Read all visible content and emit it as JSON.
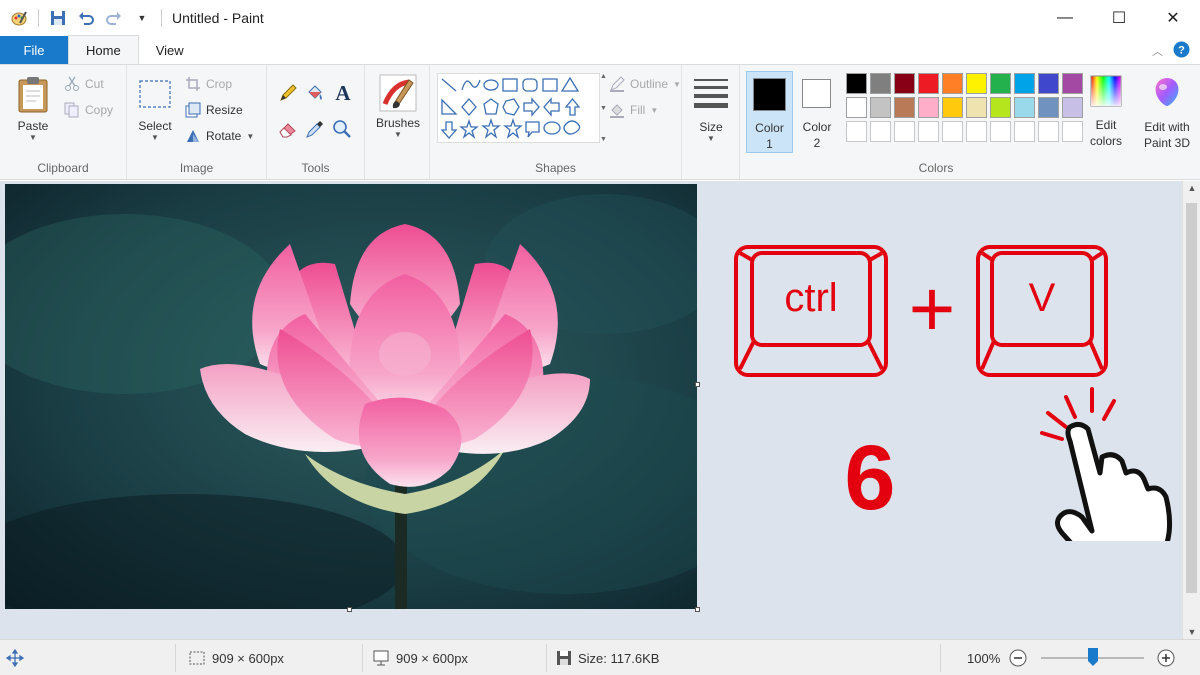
{
  "window": {
    "title": "Untitled - Paint",
    "minimize": "—",
    "maximize": "☐",
    "close": "✕"
  },
  "tabs": {
    "file": "File",
    "home": "Home",
    "view": "View"
  },
  "ribbon": {
    "clipboard": {
      "label": "Clipboard",
      "paste": "Paste",
      "cut": "Cut",
      "copy": "Copy"
    },
    "image": {
      "label": "Image",
      "select": "Select",
      "crop": "Crop",
      "resize": "Resize",
      "rotate": "Rotate"
    },
    "tools": {
      "label": "Tools"
    },
    "brushes": {
      "label": "Brushes"
    },
    "shapes": {
      "label": "Shapes",
      "outline": "Outline",
      "fill": "Fill"
    },
    "size": {
      "label": "Size"
    },
    "colors": {
      "label": "Colors",
      "color1_line1": "Color",
      "color1_line2": "1",
      "color2_line1": "Color",
      "color2_line2": "2",
      "edit_line1": "Edit",
      "edit_line2": "colors",
      "paint3d_line1": "Edit with",
      "paint3d_line2": "Paint 3D",
      "color1_value": "#000000",
      "color2_value": "#ffffff",
      "palette_row1": [
        "#000000",
        "#7f7f7f",
        "#880015",
        "#ed1c24",
        "#ff7f27",
        "#fff200",
        "#22b14c",
        "#00a2e8",
        "#3f48cc",
        "#a349a4"
      ],
      "palette_row2": [
        "#ffffff",
        "#c3c3c3",
        "#b97a57",
        "#ffaec9",
        "#ffc90e",
        "#efe4b0",
        "#b5e61d",
        "#99d9ea",
        "#7092be",
        "#c8bfe7"
      ],
      "palette_row3": [
        "#ffffff",
        "#ffffff",
        "#ffffff",
        "#ffffff",
        "#ffffff",
        "#ffffff",
        "#ffffff",
        "#ffffff",
        "#ffffff",
        "#ffffff"
      ]
    }
  },
  "overlay": {
    "key1": "ctrl",
    "plus": "+",
    "key2": "V",
    "step": "6",
    "accent": "#e3000f"
  },
  "status": {
    "selection": "909 × 600px",
    "canvas": "909 × 600px",
    "size": "Size: 117.6KB",
    "zoom": "100%",
    "zoom_level": 1.0
  }
}
